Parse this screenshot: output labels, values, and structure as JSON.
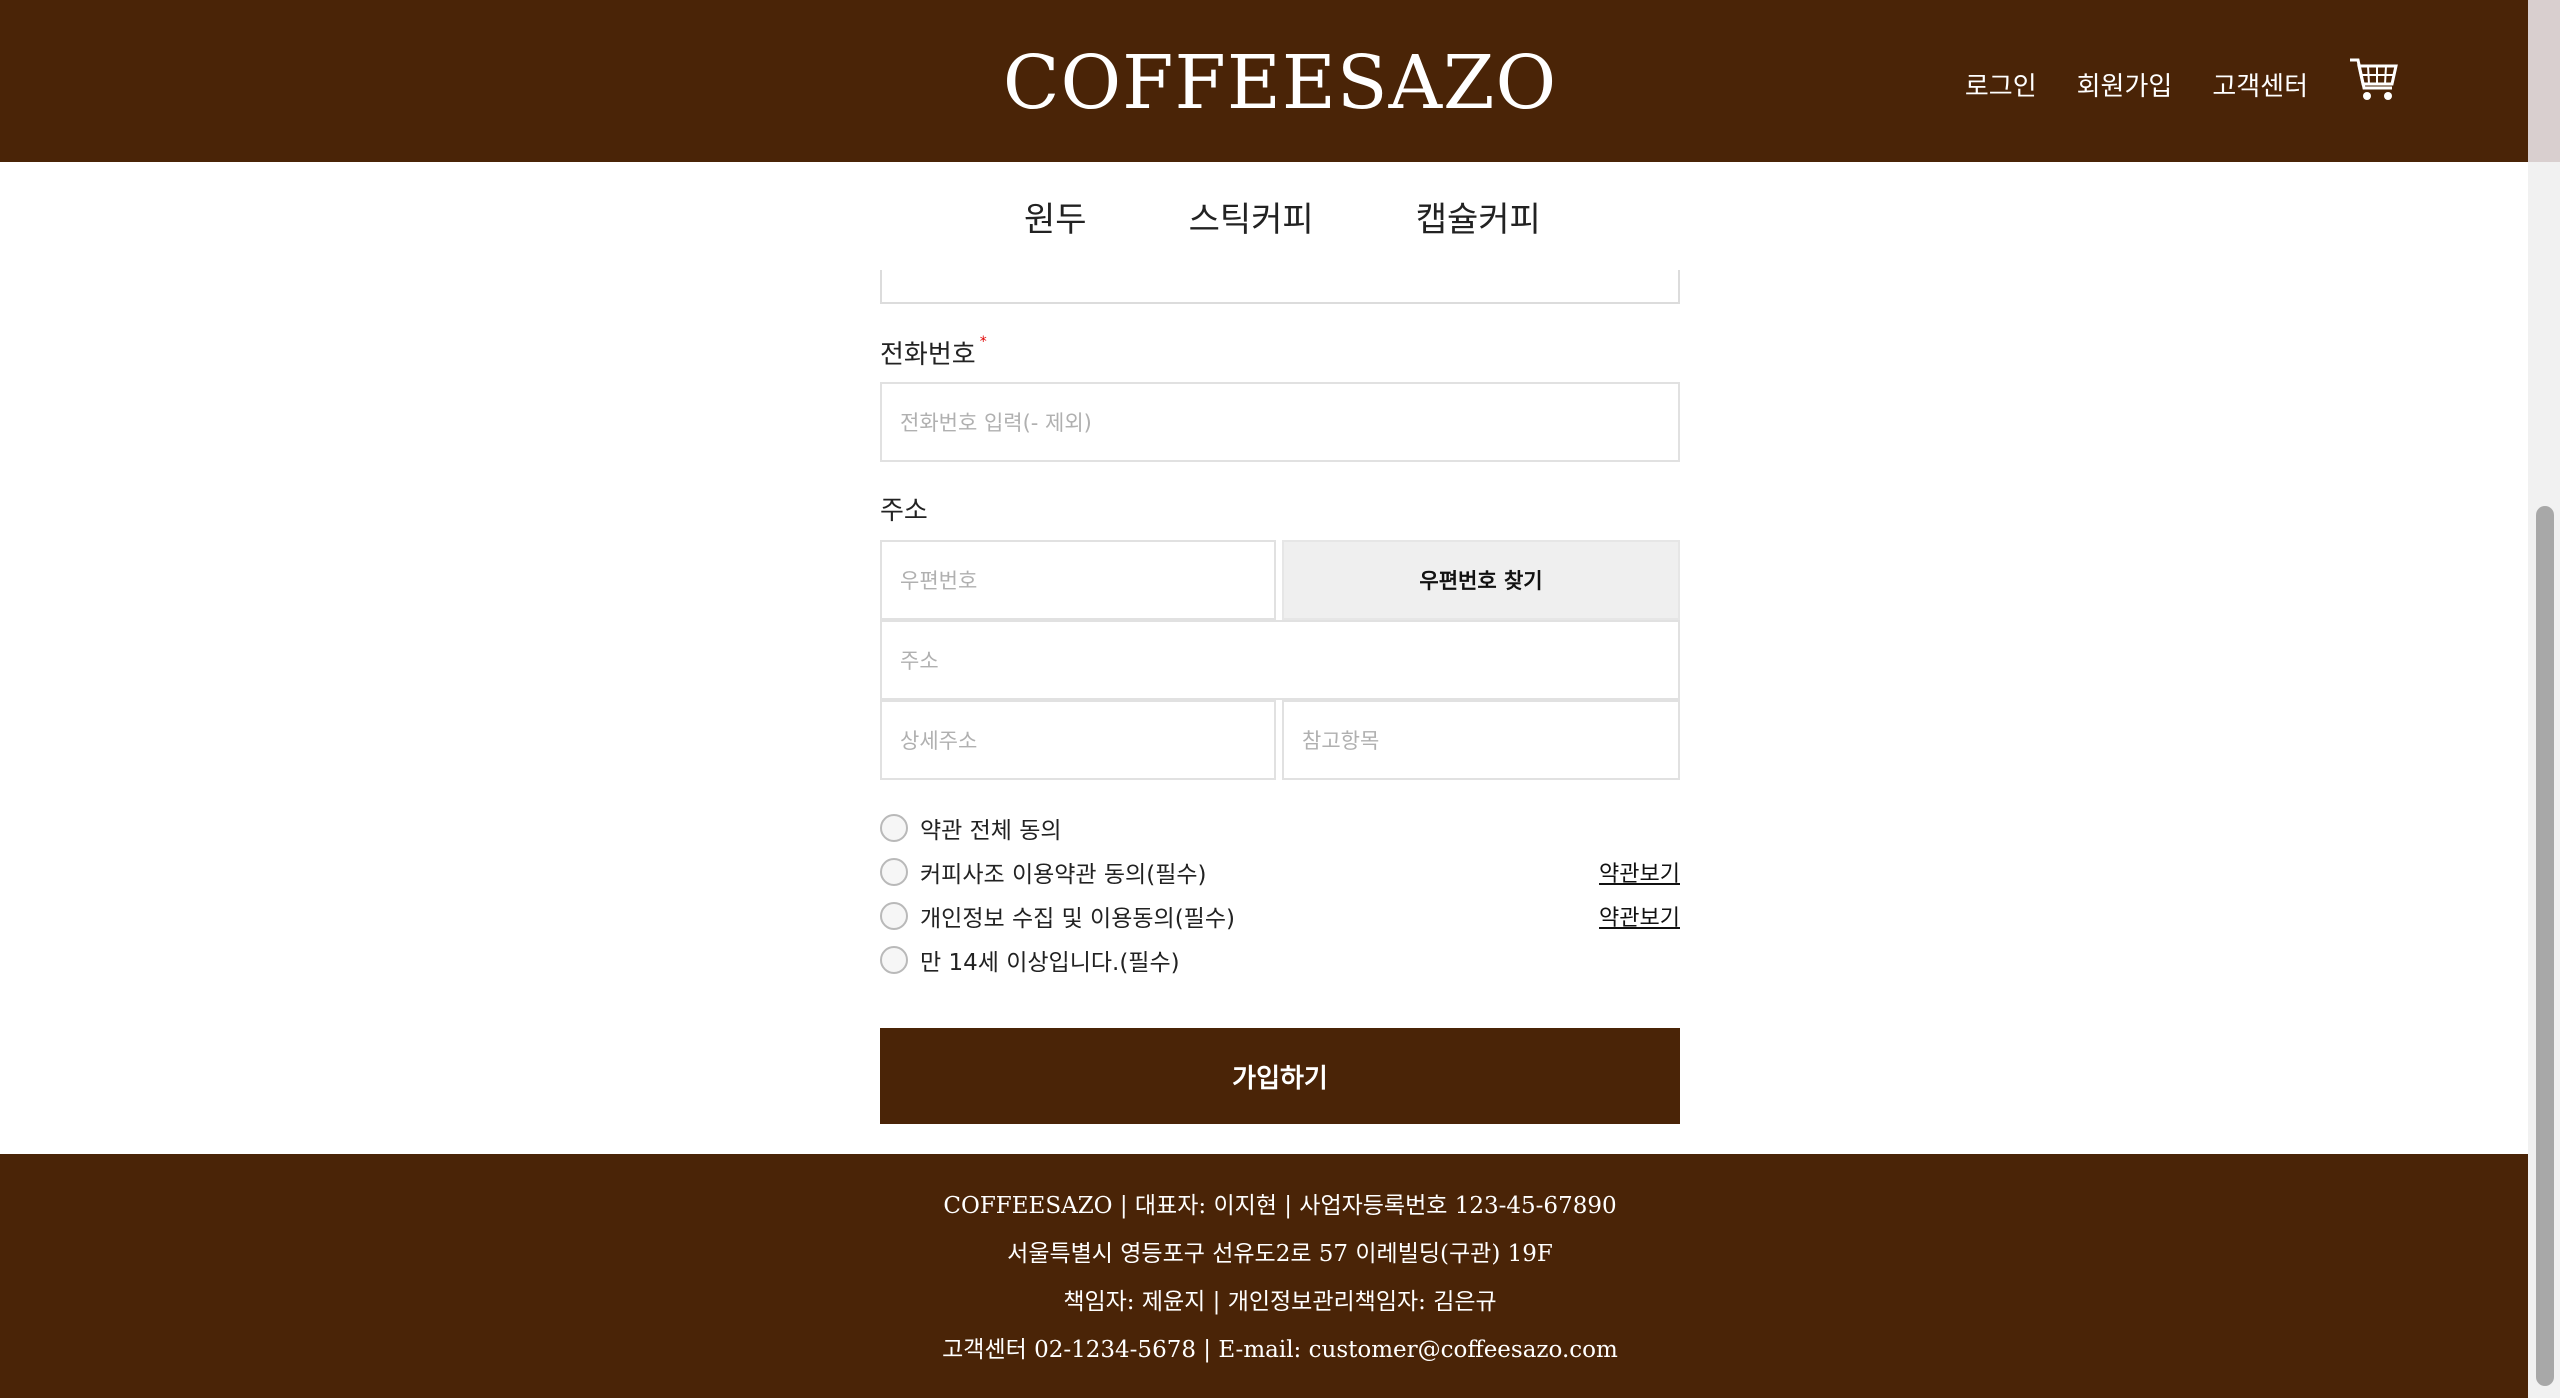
{
  "header": {
    "logo": "COFFEESAZO",
    "links": [
      "로그인",
      "회원가입",
      "고객센터"
    ],
    "cart_icon": "cart-icon"
  },
  "nav": {
    "items": [
      "원두",
      "스틱커피",
      "캡슐커피"
    ]
  },
  "form": {
    "phone_label": "전화번호",
    "required_mark": "*",
    "phone_placeholder": "전화번호 입력(- 제외)",
    "address_label": "주소",
    "postcode_placeholder": "우편번호",
    "find_postcode_button": "우편번호 찾기",
    "address_placeholder": "주소",
    "detail_placeholder": "상세주소",
    "extra_placeholder": "참고항목"
  },
  "agreements": {
    "all": "약관 전체 동의",
    "terms": "커피사조 이용약관 동의(필수)",
    "privacy": "개인정보 수집 및 이용동의(필수)",
    "age": "만 14세 이상입니다.(필수)",
    "view_link": "약관보기"
  },
  "submit_label": "가입하기",
  "footer": {
    "line1": "COFFEESAZO | 대표자: 이지현 | 사업자등록번호 123-45-67890",
    "line2": "서울특별시 영등포구 선유도2로 57 이레빌딩(구관) 19F",
    "line3": "책임자: 제윤지 | 개인정보관리책임자: 김은규",
    "line4": "고객센터 02-1234-5678 | E-mail: customer@coffeesazo.com"
  },
  "colors": {
    "brand": "#4a2407",
    "required": "#e00000"
  }
}
